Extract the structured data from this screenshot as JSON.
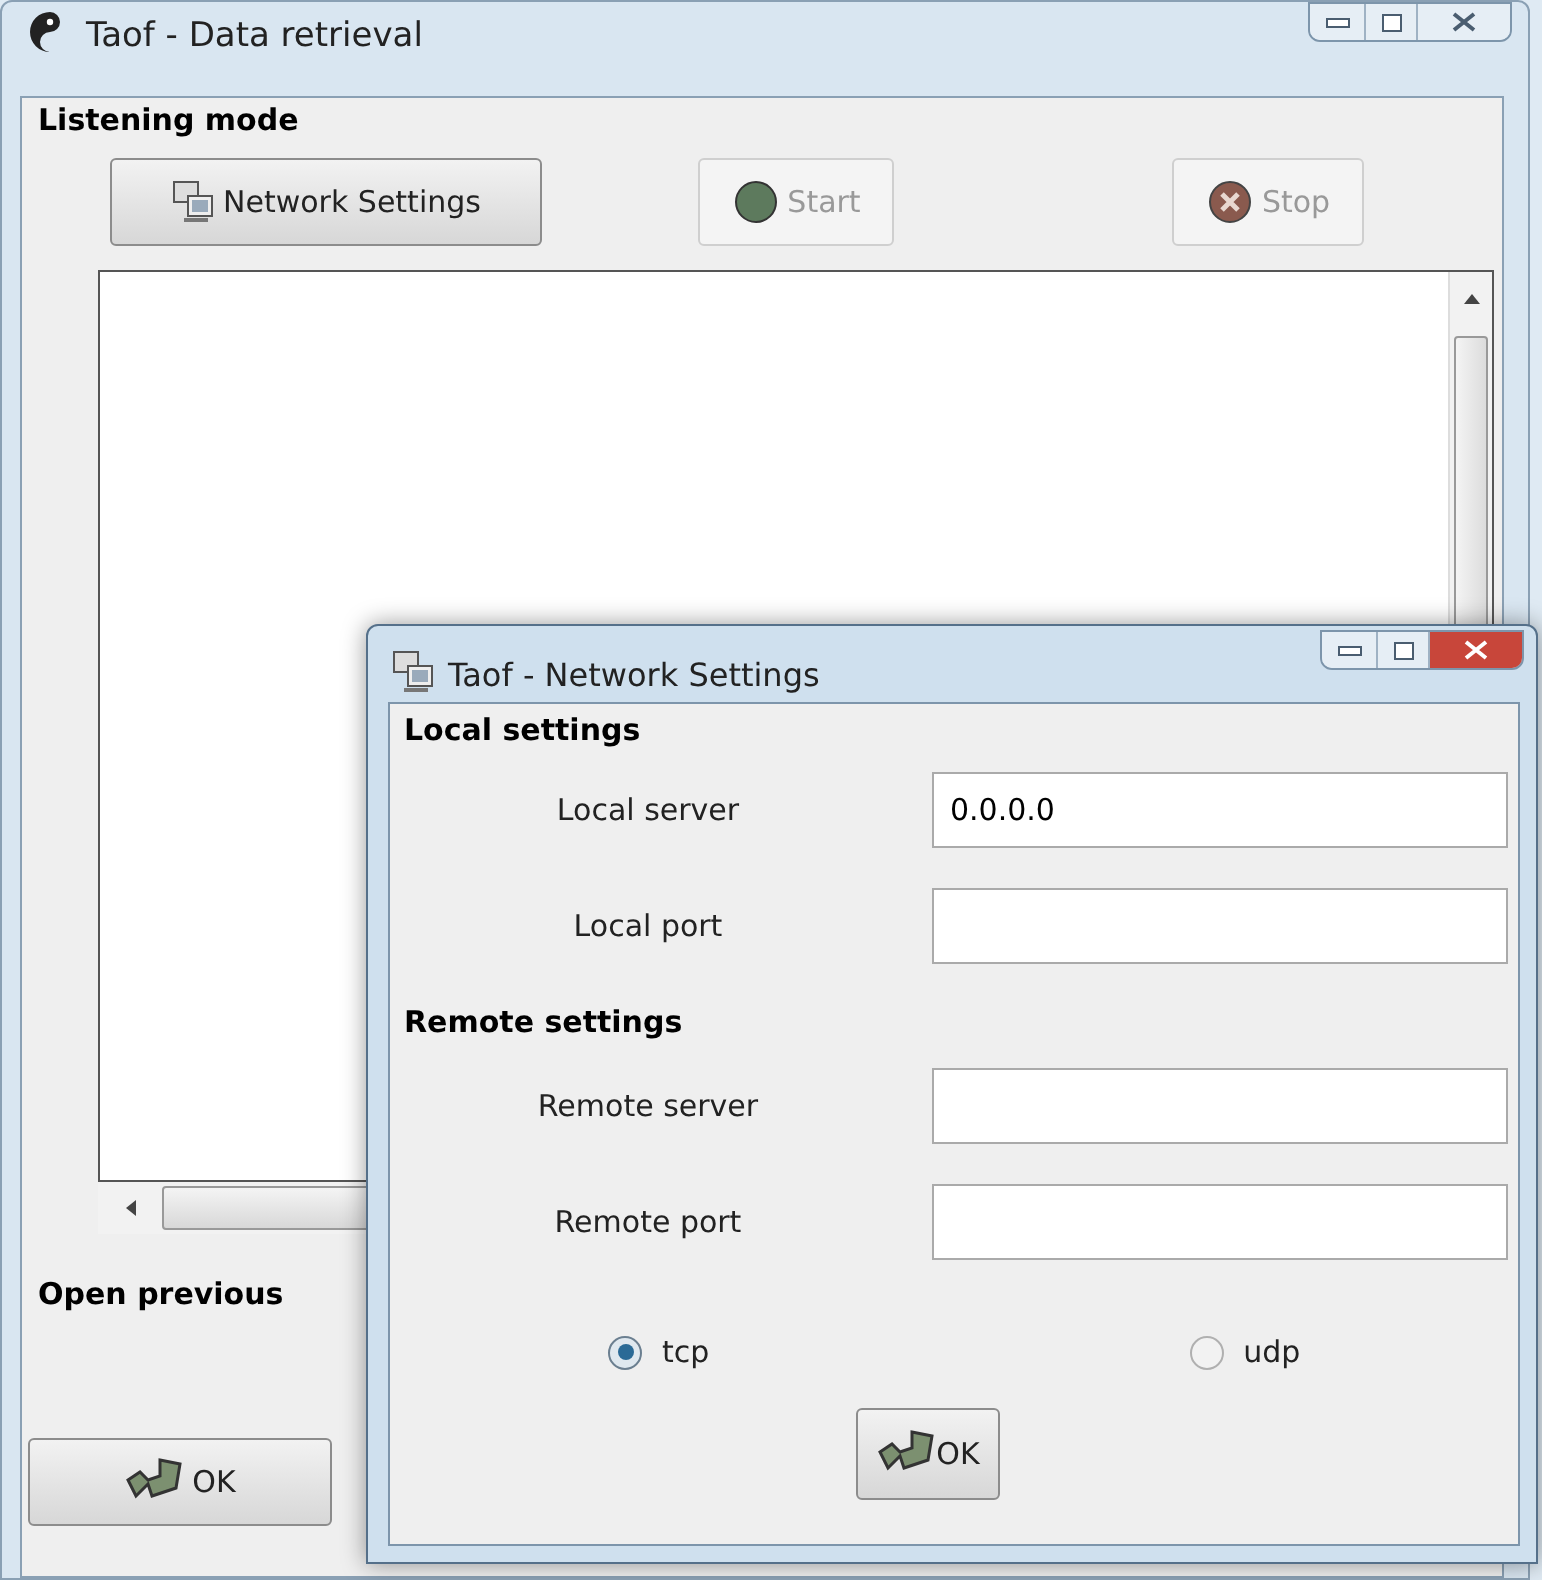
{
  "main_window": {
    "title": "Taof - Data retrieval",
    "section_title": "Listening mode",
    "buttons": [
      {
        "label": "Network Settings",
        "kind": "network",
        "disabled": false
      },
      {
        "label": "Start",
        "kind": "start",
        "disabled": true
      },
      {
        "label": "Stop",
        "kind": "stop",
        "disabled": true
      }
    ],
    "open_previous_label": "Open previous",
    "ok_button": "OK"
  },
  "dialog": {
    "title": "Taof - Network Settings",
    "groups": [
      {
        "title": "Local settings",
        "fields": [
          {
            "label": "Local server",
            "value": "0.0.0.0"
          },
          {
            "label": "Local port"
          }
        ]
      },
      {
        "title": "Remote settings",
        "fields": [
          {
            "label": "Remote server"
          },
          {
            "label": "Remote port"
          }
        ]
      }
    ],
    "protocols": [
      {
        "label": "tcp",
        "selected": true
      },
      {
        "label": "udp",
        "selected": false
      }
    ],
    "ok_button": "OK"
  }
}
